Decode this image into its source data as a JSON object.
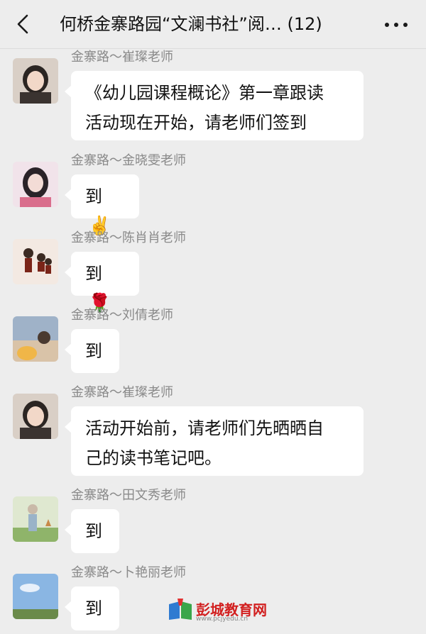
{
  "header": {
    "title": "何桥金寨路园“文澜书社”阅…  (12)",
    "back_icon": "chevron-left-icon",
    "more_icon": "more-dots-icon"
  },
  "messages": [
    {
      "sender": "金寨路～崔璨老师",
      "text_lines": [
        "《幼儿园课程概论》第一章跟读",
        "活动现在开始，请老师们签到"
      ],
      "emoji": ""
    },
    {
      "sender": "金寨路～金晓雯老师",
      "text_lines": [
        "到"
      ],
      "emoji": "✌️"
    },
    {
      "sender": "金寨路～陈肖肖老师",
      "text_lines": [
        "到"
      ],
      "emoji": "🌹"
    },
    {
      "sender": "金寨路～刘倩老师",
      "text_lines": [
        "到"
      ],
      "emoji": ""
    },
    {
      "sender": "金寨路～崔璨老师",
      "text_lines": [
        "活动开始前，请老师们先晒晒自",
        "己的读书笔记吧。"
      ],
      "emoji": ""
    },
    {
      "sender": "金寨路～田文秀老师",
      "text_lines": [
        "到"
      ],
      "emoji": ""
    },
    {
      "sender": "金寨路～卜艳丽老师",
      "text_lines": [
        "到"
      ],
      "emoji": ""
    }
  ],
  "watermark": {
    "name": "彭城教育网",
    "url": "www.pcjyedu.cn"
  },
  "colors": {
    "background": "#ededed",
    "bubble": "#ffffff",
    "sender_text": "#8a8a8a"
  }
}
